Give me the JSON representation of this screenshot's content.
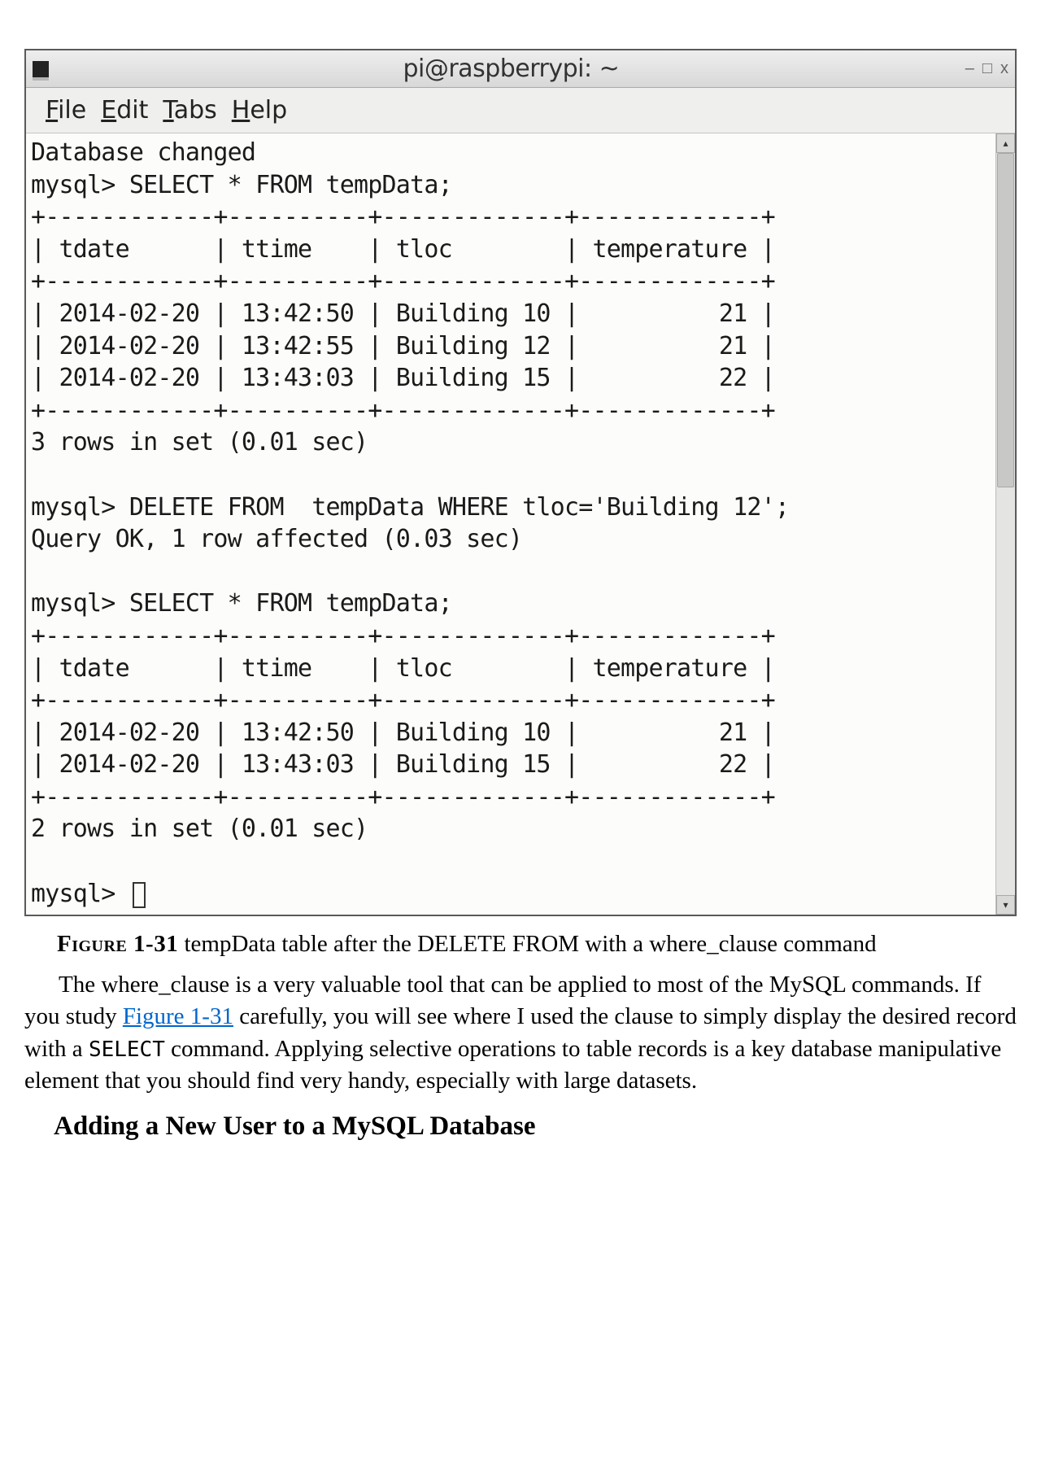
{
  "window": {
    "title": "pi@raspberrypi: ~",
    "controls": {
      "minimize": "–",
      "maximize": "□",
      "close": "x"
    }
  },
  "menubar": {
    "file": "File",
    "edit": "Edit",
    "tabs": "Tabs",
    "help": "Help"
  },
  "terminal": {
    "db_changed": "Database changed",
    "prompt1": "mysql> SELECT * FROM tempData;",
    "border_top1": "+------------+----------+-------------+-------------+",
    "header1": "| tdate      | ttime    | tloc        | temperature |",
    "border_mid1": "+------------+----------+-------------+-------------+",
    "row1a": "| 2014-02-20 | 13:42:50 | Building 10 |          21 |",
    "row1b": "| 2014-02-20 | 13:42:55 | Building 12 |          21 |",
    "row1c": "| 2014-02-20 | 13:43:03 | Building 15 |          22 |",
    "border_bot1": "+------------+----------+-------------+-------------+",
    "summary1": "3 rows in set (0.01 sec)",
    "delete_cmd": "mysql> DELETE FROM  tempData WHERE tloc='Building 12';",
    "delete_result": "Query OK, 1 row affected (0.03 sec)",
    "prompt2": "mysql> SELECT * FROM tempData;",
    "border_top2": "+------------+----------+-------------+-------------+",
    "header2": "| tdate      | ttime    | tloc        | temperature |",
    "border_mid2": "+------------+----------+-------------+-------------+",
    "row2a": "| 2014-02-20 | 13:42:50 | Building 10 |          21 |",
    "row2b": "| 2014-02-20 | 13:43:03 | Building 15 |          22 |",
    "border_bot2": "+------------+----------+-------------+-------------+",
    "summary2": "2 rows in set (0.01 sec)",
    "prompt_final": "mysql> "
  },
  "table1": {
    "columns": [
      "tdate",
      "ttime",
      "tloc",
      "temperature"
    ],
    "rows": [
      {
        "tdate": "2014-02-20",
        "ttime": "13:42:50",
        "tloc": "Building 10",
        "temperature": 21
      },
      {
        "tdate": "2014-02-20",
        "ttime": "13:42:55",
        "tloc": "Building 12",
        "temperature": 21
      },
      {
        "tdate": "2014-02-20",
        "ttime": "13:43:03",
        "tloc": "Building 15",
        "temperature": 22
      }
    ],
    "summary": "3 rows in set (0.01 sec)"
  },
  "table2": {
    "columns": [
      "tdate",
      "ttime",
      "tloc",
      "temperature"
    ],
    "rows": [
      {
        "tdate": "2014-02-20",
        "ttime": "13:42:50",
        "tloc": "Building 10",
        "temperature": 21
      },
      {
        "tdate": "2014-02-20",
        "ttime": "13:43:03",
        "tloc": "Building 15",
        "temperature": 22
      }
    ],
    "summary": "2 rows in set (0.01 sec)"
  },
  "caption": {
    "label": "Figure 1-31",
    "text": " tempData table after the DELETE FROM with a where_clause command"
  },
  "paragraph": {
    "part1": "The where_clause is a very valuable tool that can be applied to most of the MySQL commands. If you study ",
    "link": "Figure 1-31",
    "part2": " carefully, you will see where I used the clause to simply display the desired record with a ",
    "code": "SELECT",
    "part3": " command. Applying selective operations to table records is a key database manipulative element that you should find very handy, especially with large datasets."
  },
  "heading": "Adding a New User to a MySQL Database"
}
